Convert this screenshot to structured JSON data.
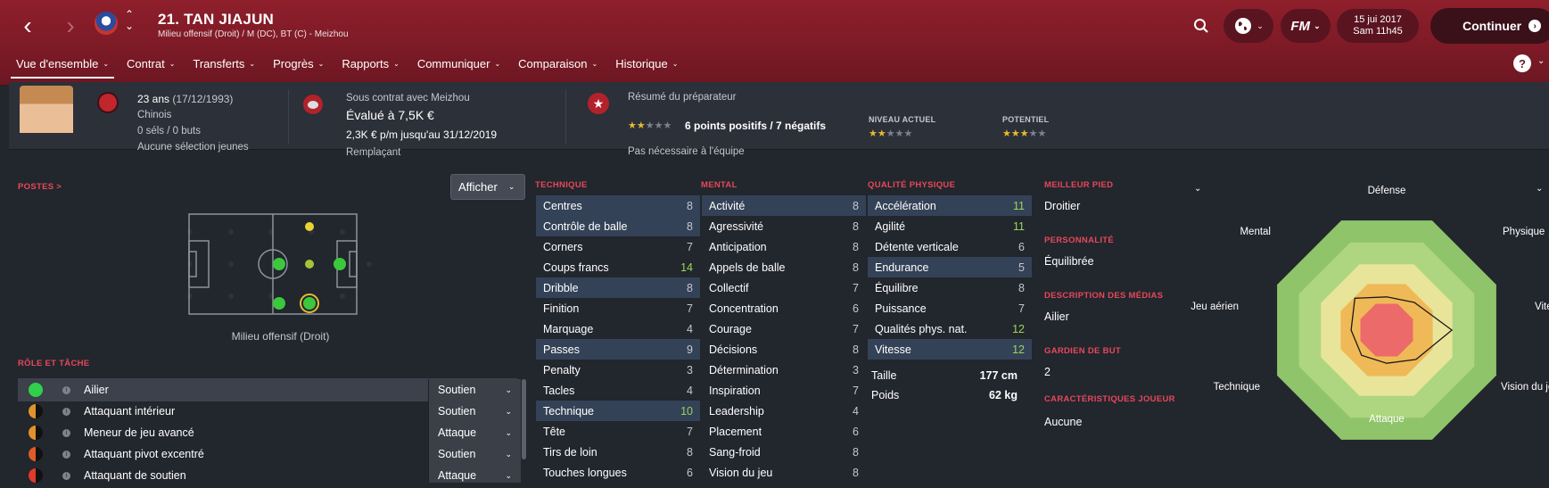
{
  "header": {
    "player_title": "21. TAN JIAJUN",
    "player_subtitle": "Milieu offensif (Droit) / M (DC), BT (C) - Meizhou",
    "date_line1": "15 jui 2017",
    "date_line2": "Sam 11h45",
    "fm_label": "FM",
    "continue_label": "Continuer",
    "help_label": "?"
  },
  "tabs": [
    {
      "label": "Vue d'ensemble",
      "active": true
    },
    {
      "label": "Contrat"
    },
    {
      "label": "Transferts"
    },
    {
      "label": "Progrès"
    },
    {
      "label": "Rapports"
    },
    {
      "label": "Communiquer"
    },
    {
      "label": "Comparaison"
    },
    {
      "label": "Historique"
    }
  ],
  "info": {
    "age": "23 ans",
    "birth": "(17/12/1993)",
    "nationality": "Chinois",
    "caps": "0 séls / 0 buts",
    "youth": "Aucune sélection jeunes",
    "contract_with": "Sous contrat avec Meizhou",
    "value": "Évalué à 7,5K €",
    "wage": "2,3K € p/m jusqu'au 31/12/2019",
    "squad_status": "Remplaçant",
    "coach_summary": "Résumé du préparateur",
    "points": "6 points positifs / 7 négatifs",
    "squad_need": "Pas nécessaire à l'équipe",
    "current_ability_label": "NIVEAU ACTUEL",
    "potential_label": "POTENTIEL",
    "summary_stars": 2,
    "current_stars": 2,
    "potential_stars": 3
  },
  "positions": {
    "label": "POSTES >",
    "afficher": "Afficher",
    "caption": "Milieu offensif (Droit)"
  },
  "roles": {
    "label": "RÔLE ET TÂCHE",
    "items": [
      {
        "name": "Ailier",
        "duty": "Soutien",
        "color": "#2fd14a"
      },
      {
        "name": "Attaquant intérieur",
        "duty": "Soutien",
        "color": "#e0932a"
      },
      {
        "name": "Meneur de jeu avancé",
        "duty": "Attaque",
        "color": "#e0932a"
      },
      {
        "name": "Attaquant pivot excentré",
        "duty": "Soutien",
        "color": "#e05a2a"
      },
      {
        "name": "Attaquant de soutien",
        "duty": "Attaque",
        "color": "#e03a2a"
      }
    ]
  },
  "technique": {
    "label": "TECHNIQUE",
    "items": [
      {
        "name": "Centres",
        "value": "8",
        "hl": true
      },
      {
        "name": "Contrôle de balle",
        "value": "8",
        "hl": true
      },
      {
        "name": "Corners",
        "value": "7"
      },
      {
        "name": "Coups francs",
        "value": "14",
        "good": true
      },
      {
        "name": "Dribble",
        "value": "8",
        "hl": true
      },
      {
        "name": "Finition",
        "value": "7"
      },
      {
        "name": "Marquage",
        "value": "4"
      },
      {
        "name": "Passes",
        "value": "9",
        "hl": true
      },
      {
        "name": "Penalty",
        "value": "3"
      },
      {
        "name": "Tacles",
        "value": "4"
      },
      {
        "name": "Technique",
        "value": "10",
        "hl": true,
        "good": true
      },
      {
        "name": "Tête",
        "value": "7"
      },
      {
        "name": "Tirs de loin",
        "value": "8"
      },
      {
        "name": "Touches longues",
        "value": "6"
      }
    ]
  },
  "mental": {
    "label": "MENTAL",
    "items": [
      {
        "name": "Activité",
        "value": "8",
        "hl": true
      },
      {
        "name": "Agressivité",
        "value": "8"
      },
      {
        "name": "Anticipation",
        "value": "8"
      },
      {
        "name": "Appels de balle",
        "value": "8"
      },
      {
        "name": "Collectif",
        "value": "7"
      },
      {
        "name": "Concentration",
        "value": "6"
      },
      {
        "name": "Courage",
        "value": "7"
      },
      {
        "name": "Décisions",
        "value": "8"
      },
      {
        "name": "Détermination",
        "value": "3"
      },
      {
        "name": "Inspiration",
        "value": "7"
      },
      {
        "name": "Leadership",
        "value": "4"
      },
      {
        "name": "Placement",
        "value": "6"
      },
      {
        "name": "Sang-froid",
        "value": "8"
      },
      {
        "name": "Vision du jeu",
        "value": "8"
      }
    ]
  },
  "physical": {
    "label": "QUALITÉ PHYSIQUE",
    "items": [
      {
        "name": "Accélération",
        "value": "11",
        "hl": true,
        "good": true
      },
      {
        "name": "Agilité",
        "value": "11",
        "good": true
      },
      {
        "name": "Détente verticale",
        "value": "6"
      },
      {
        "name": "Endurance",
        "value": "5",
        "hl": true
      },
      {
        "name": "Équilibre",
        "value": "8"
      },
      {
        "name": "Puissance",
        "value": "7"
      },
      {
        "name": "Qualités phys. nat.",
        "value": "12",
        "good": true
      },
      {
        "name": "Vitesse",
        "value": "12",
        "hl": true,
        "good": true
      }
    ],
    "height_label": "Taille",
    "height": "177 cm",
    "weight_label": "Poids",
    "weight": "62 kg"
  },
  "profile": {
    "foot_label": "MEILLEUR PIED",
    "foot": "Droitier",
    "personality_label": "PERSONNALITÉ",
    "personality": "Équilibrée",
    "media_label": "DESCRIPTION DES MÉDIAS",
    "media": "Ailier",
    "gk_label": "GARDIEN DE BUT",
    "gk": "2",
    "traits_label": "CARACTÉRISTIQUES JOUEUR",
    "traits": "Aucune"
  },
  "radar": {
    "labels": [
      "Défense",
      "Physique",
      "Vitesse",
      "Vision du jeu",
      "Attaque",
      "Technique",
      "Jeu aérien",
      "Mental"
    ],
    "values": [
      0.28,
      0.33,
      0.55,
      0.35,
      0.28,
      0.3,
      0.3,
      0.38
    ]
  }
}
